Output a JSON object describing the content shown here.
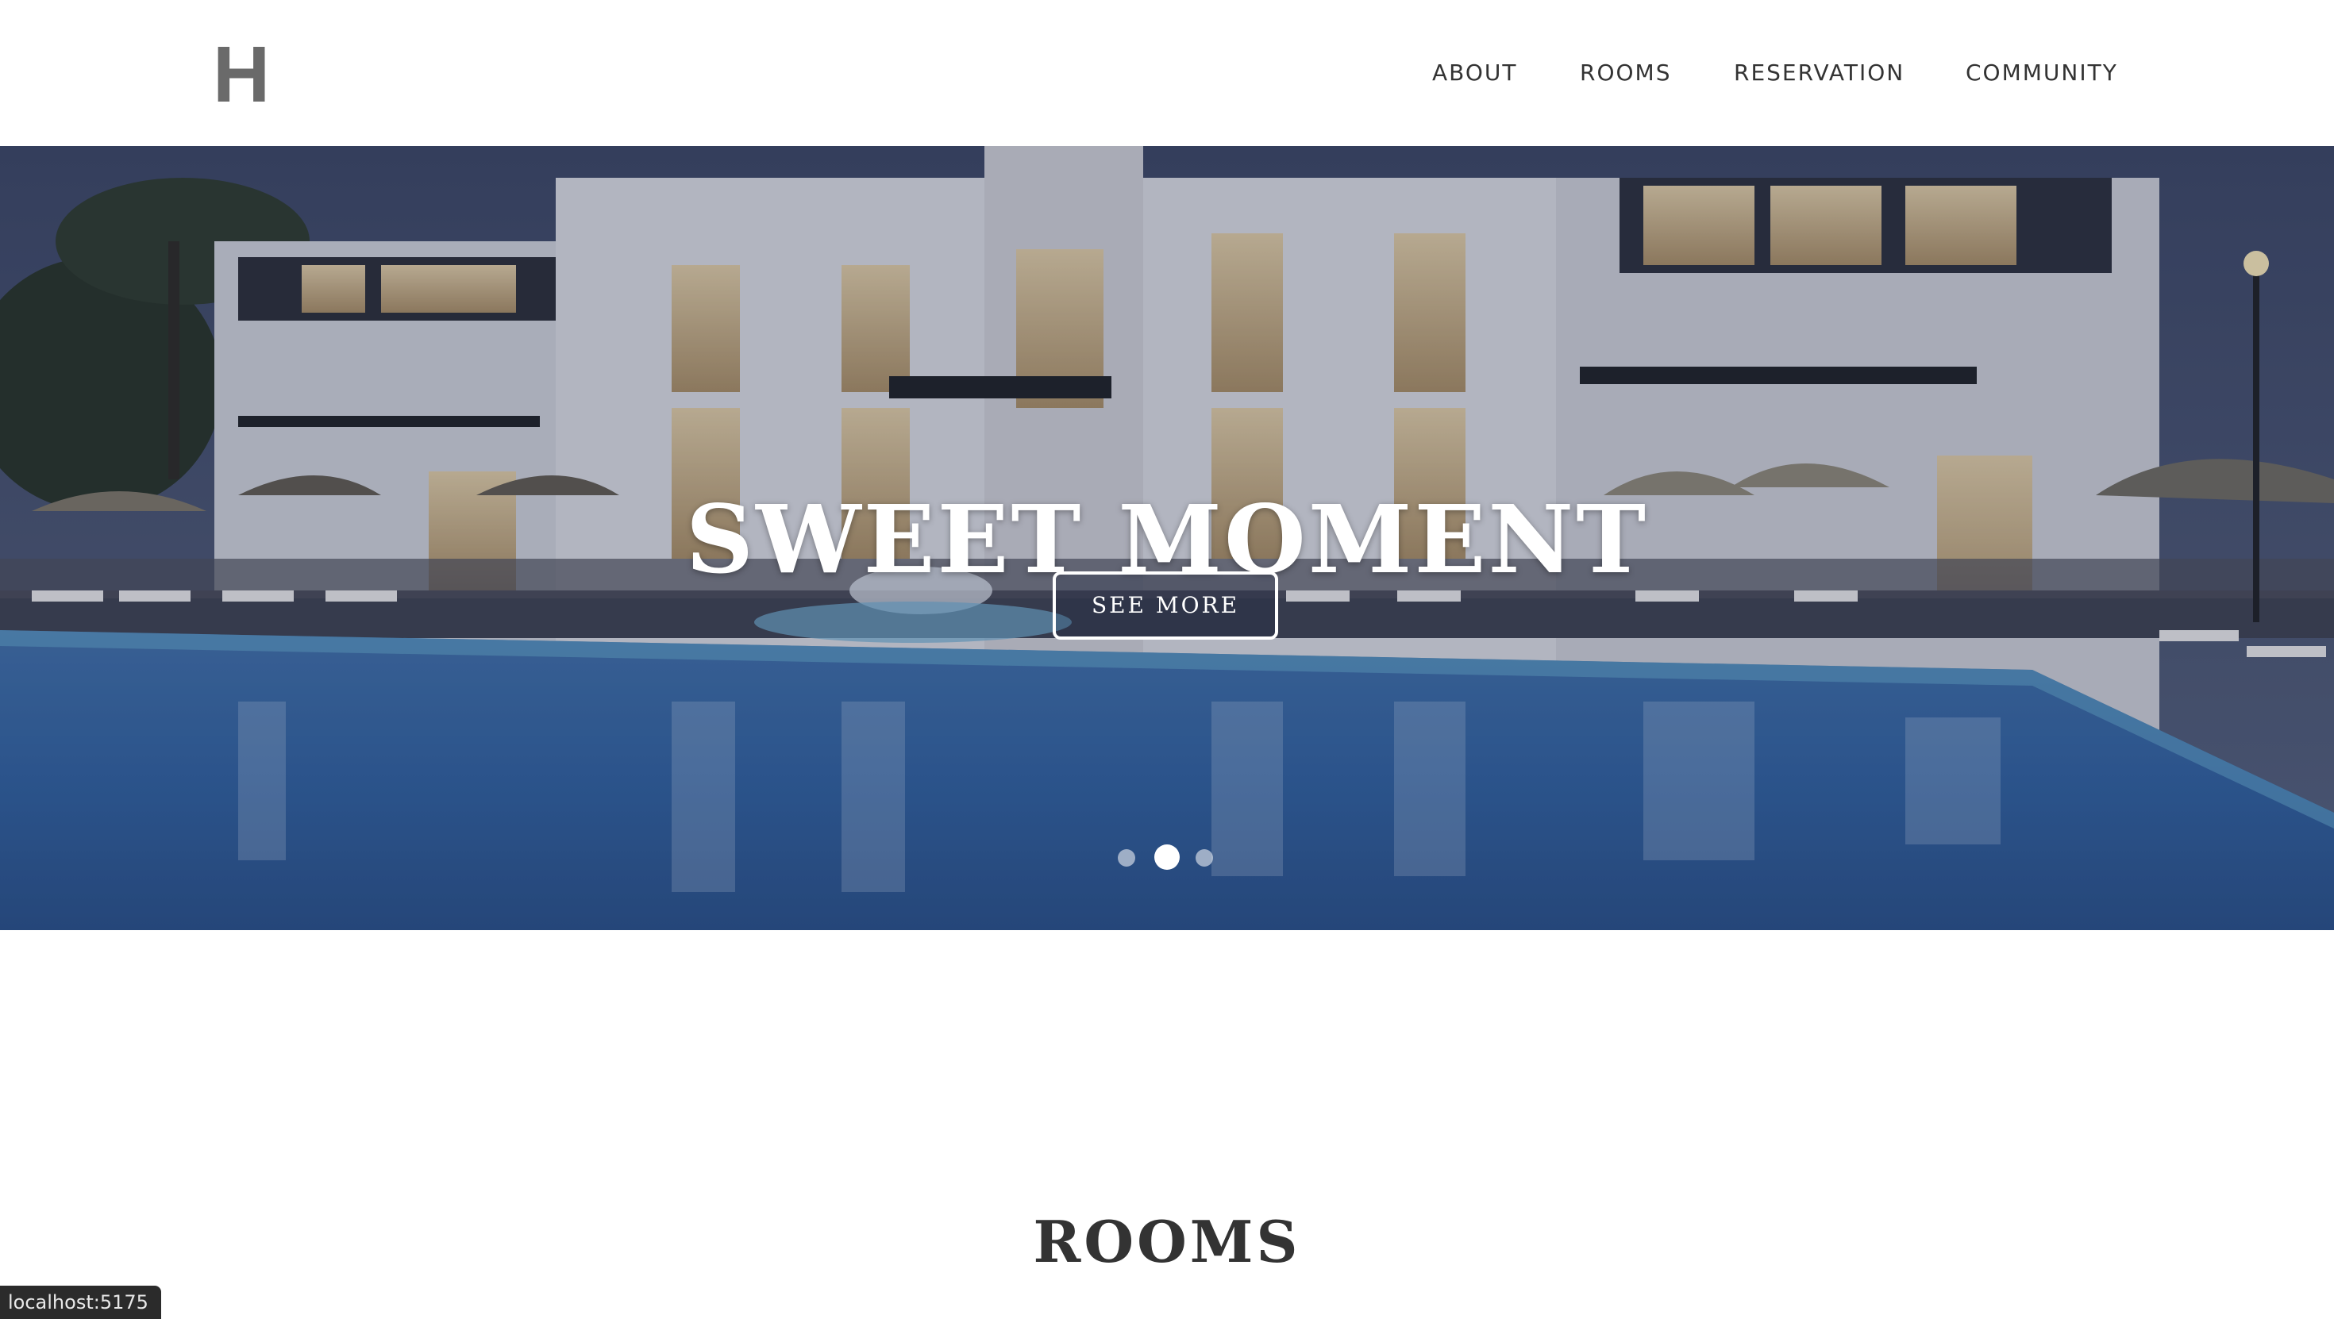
{
  "header": {
    "logo": "H",
    "nav": [
      {
        "label": "ABOUT"
      },
      {
        "label": "ROOMS"
      },
      {
        "label": "RESERVATION"
      },
      {
        "label": "COMMUNITY"
      }
    ]
  },
  "hero": {
    "title": "SWEET MOMENT",
    "button_label": "SEE MORE",
    "slides": {
      "count": 3,
      "active_index": 1
    }
  },
  "rooms_section": {
    "title": "ROOMS"
  },
  "status_bar": {
    "url": "localhost:5175"
  },
  "colors": {
    "logo": "#6a6a6a",
    "nav_text": "#333333",
    "pool_water": "#2e5f9c",
    "night_sky": "#3e4a6a"
  }
}
